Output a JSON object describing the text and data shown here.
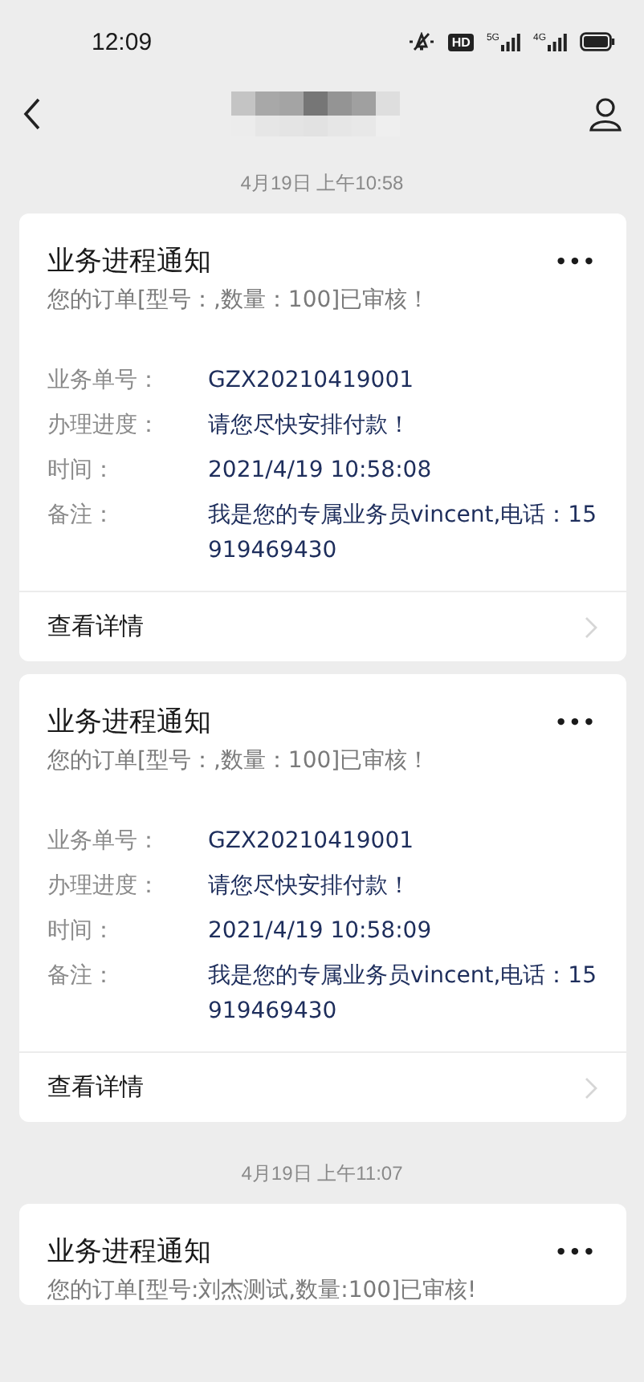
{
  "status_bar": {
    "time": "12:09",
    "hd_label": "HD",
    "networks": [
      "5G",
      "4G"
    ]
  },
  "messages": [
    {
      "kind": "timestamp",
      "text": "4月19日 上午10:58"
    },
    {
      "kind": "card",
      "title": "业务进程通知",
      "more": "•••",
      "summary": "您的订单[型号：,数量：100]已审核！",
      "fields": [
        {
          "label": "业务单号：",
          "value": "GZX20210419001"
        },
        {
          "label": "办理进度：",
          "value": "请您尽快安排付款！"
        },
        {
          "label": "时间：",
          "value": "2021/4/19 10:58:08"
        },
        {
          "label": "备注：",
          "value": "我是您的专属业务员vincent,电话：15919469430"
        }
      ],
      "link": "查看详情"
    },
    {
      "kind": "card",
      "title": "业务进程通知",
      "more": "•••",
      "summary": "您的订单[型号：,数量：100]已审核！",
      "fields": [
        {
          "label": "业务单号：",
          "value": "GZX20210419001"
        },
        {
          "label": "办理进度：",
          "value": "请您尽快安排付款！"
        },
        {
          "label": "时间：",
          "value": "2021/4/19 10:58:09"
        },
        {
          "label": "备注：",
          "value": "我是您的专属业务员vincent,电话：15919469430"
        }
      ],
      "link": "查看详情"
    },
    {
      "kind": "timestamp",
      "text": "4月19日 上午11:07"
    },
    {
      "kind": "card",
      "title": "业务进程通知",
      "more": "•••",
      "summary": "您的订单[型号:刘杰测试,数量:100]已审核!"
    }
  ]
}
